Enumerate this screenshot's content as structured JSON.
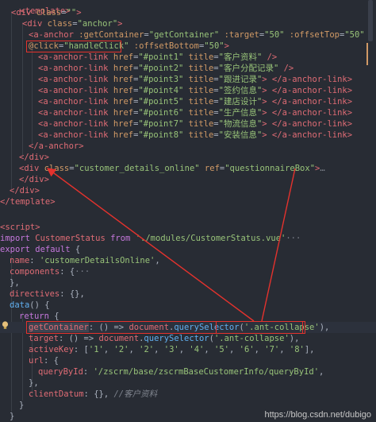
{
  "colors": {
    "background": "#282c34",
    "tag": "#e06c75",
    "attr": "#d19a66",
    "string": "#98c379",
    "keyword": "#c678dd",
    "function": "#61afef",
    "annotation": "#e5322d"
  },
  "code": {
    "l01": {
      "a": "<template>"
    },
    "l02": {
      "a": "<div",
      "b": " class",
      "c": "=",
      "d": "\"\"",
      "e": ">"
    },
    "l03": {
      "a": "<div",
      "b": " class",
      "c": "=",
      "d": "\"anchor\"",
      "e": ">"
    },
    "l04": {
      "a": "<a-anchor",
      "b": " :getContainer",
      "c": "=",
      "d": "\"getContainer\"",
      "f": " :target",
      "g": "=",
      "h": "\"50\"",
      "i": " :offsetTop",
      "j": "=",
      "k": "\"50\""
    },
    "l05": {
      "a": "@click",
      "b": "=",
      "c": "\"handleClick\"",
      "d": " :offsetBottom",
      "e": "=",
      "f": "\"50\"",
      "g": ">"
    },
    "links": [
      {
        "tag": "<a-anchor-link",
        "href_attr": " href",
        "href": "\"#point1\"",
        "title_attr": " title",
        "title": "\"客户资料\"",
        "end": " />"
      },
      {
        "tag": "<a-anchor-link",
        "href_attr": " href",
        "href": "\"#point2\"",
        "title_attr": " title",
        "title": "\"客户分配记录\"",
        "end": " />"
      },
      {
        "tag": "<a-anchor-link",
        "href_attr": " href",
        "href": "\"#point3\"",
        "title_attr": " title",
        "title": "\"跟进记录\"",
        "end": "> </a-anchor-link>"
      },
      {
        "tag": "<a-anchor-link",
        "href_attr": " href",
        "href": "\"#point4\"",
        "title_attr": " title",
        "title": "\"签约信息\"",
        "end": "> </a-anchor-link>"
      },
      {
        "tag": "<a-anchor-link",
        "href_attr": " href",
        "href": "\"#point5\"",
        "title_attr": " title",
        "title": "\"建店设计\"",
        "end": "> </a-anchor-link>"
      },
      {
        "tag": "<a-anchor-link",
        "href_attr": " href",
        "href": "\"#point6\"",
        "title_attr": " title",
        "title": "\"生产信息\"",
        "end": "> </a-anchor-link>"
      },
      {
        "tag": "<a-anchor-link",
        "href_attr": " href",
        "href": "\"#point7\"",
        "title_attr": " title",
        "title": "\"物流信息\"",
        "end": "> </a-anchor-link>"
      },
      {
        "tag": "<a-anchor-link",
        "href_attr": " href",
        "href": "\"#point8\"",
        "title_attr": " title",
        "title": "\"安装信息\"",
        "end": "> </a-anchor-link>"
      }
    ],
    "l14": {
      "a": "</a-anchor>"
    },
    "l15": {
      "a": "</div>"
    },
    "l16": {
      "a": "<div",
      "b": " class",
      "c": "=",
      "d": "\"customer_details_online\"",
      "e": " ref",
      "f": "=",
      "g": "\"questionnaireBox\"",
      "h": ">",
      "fold": "…"
    },
    "l17": {
      "a": "</div>"
    },
    "l18": {
      "a": "</div>"
    },
    "l19": {
      "a": "</template>"
    },
    "l21": {
      "a": "<script>"
    },
    "l22": {
      "a": "import",
      "b": " CustomerStatus ",
      "c": "from",
      "d": " './modules/CustomerStatus.vue'",
      "fold": "···"
    },
    "l23": {
      "a": "export",
      "b": " default",
      "c": " {"
    },
    "l24": {
      "a": "name",
      "b": ": ",
      "c": "'customerDetailsOnline'",
      "d": ","
    },
    "l25": {
      "a": "components",
      "b": ": {",
      "fold": "···"
    },
    "l26": {
      "a": "},"
    },
    "l27": {
      "a": "directives",
      "b": ": {},",
      "c": ""
    },
    "l28": {
      "a": "data",
      "b": "() {"
    },
    "l29": {
      "a": "return",
      "b": " {"
    },
    "l30": {
      "a": "getContainer",
      "b": ": () => ",
      "c": "document",
      "d": ".",
      "e": "querySelector",
      "f": "(",
      "g": "'.ant-collapse'",
      "h": "),",
      "i": ""
    },
    "l31": {
      "a": "target",
      "b": ": () => ",
      "c": "document",
      "d": ".",
      "e": "querySelector",
      "f": "(",
      "g": "'.ant-collapse'",
      "h": "),"
    },
    "l32": {
      "a": "activeKey",
      "b": ": [",
      "c": "'1'",
      "d": ", ",
      "e": "'2'",
      "f": ", ",
      "g": "'2'",
      "h": ", ",
      "i": "'3'",
      "j": ", ",
      "k": "'4'",
      "l": ", ",
      "m": "'5'",
      "n": ", ",
      "o": "'6'",
      "p": ", ",
      "q": "'7'",
      "r": ", ",
      "s": "'8'",
      "t": "],"
    },
    "l33": {
      "a": "url",
      "b": ": {"
    },
    "l34": {
      "a": "queryById",
      "b": ": ",
      "c": "'/zscrm/base/zscrmBaseCustomerInfo/queryById'",
      "d": ","
    },
    "l35": {
      "a": "},"
    },
    "l36": {
      "a": "clientDatum",
      "b": ": {}, ",
      "c": "//客户资料"
    },
    "l37": {
      "a": "}"
    },
    "l38": {
      "a": "}"
    }
  },
  "watermark": "https://blog.csdn.net/dubigo"
}
